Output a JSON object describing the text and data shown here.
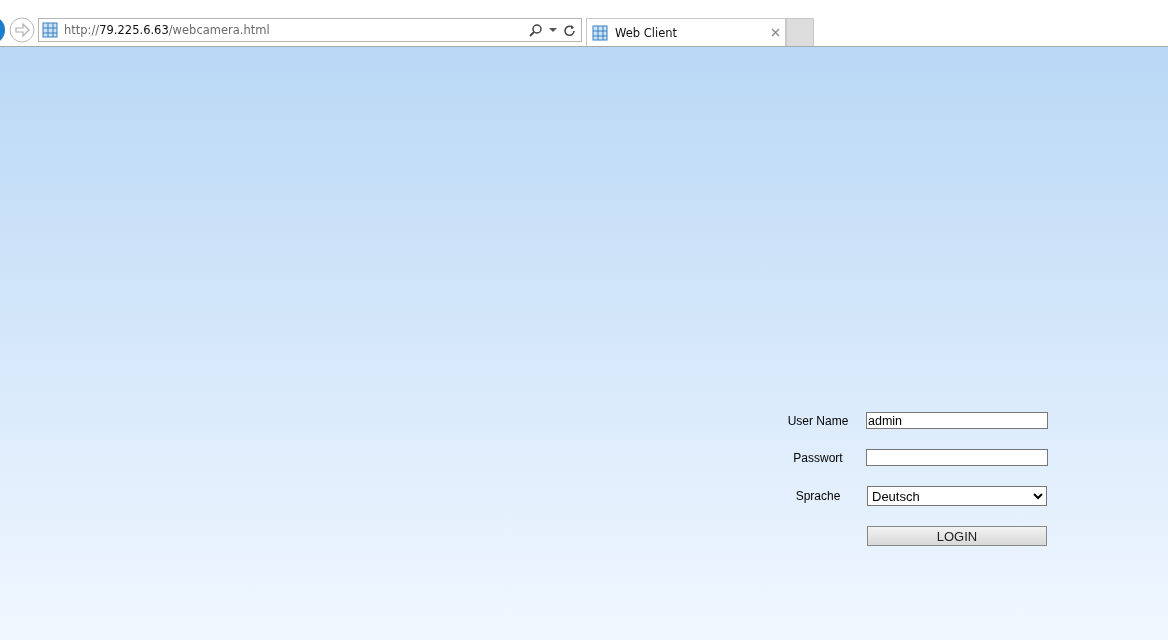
{
  "address_bar": {
    "url_scheme": "http://",
    "url_host": "79.225.6.63",
    "url_path": "/webcamera.html"
  },
  "tabs": [
    {
      "label": "Web Client",
      "selected": true
    }
  ],
  "login_form": {
    "fields": [
      {
        "kind": "text",
        "label": "User Name",
        "value": "admin"
      },
      {
        "kind": "password",
        "label": "Passwort"
      },
      {
        "kind": "select",
        "label": "Sprache",
        "value": "Deutsch"
      }
    ],
    "button": "LOGIN"
  }
}
